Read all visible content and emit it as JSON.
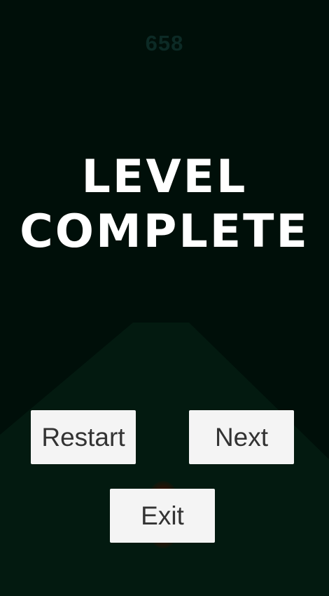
{
  "game": {
    "score": "658",
    "title_line1": "LEVEL",
    "title_line2": "COMPLETE"
  },
  "buttons": {
    "restart_label": "Restart",
    "next_label": "Next",
    "exit_label": "Exit"
  },
  "colors": {
    "background": "#000f09",
    "score_text": "#0c2a25",
    "title_text": "#ffffff",
    "button_fill": "#f4f4f4",
    "button_text": "#333333",
    "ramp": "#031a10"
  }
}
